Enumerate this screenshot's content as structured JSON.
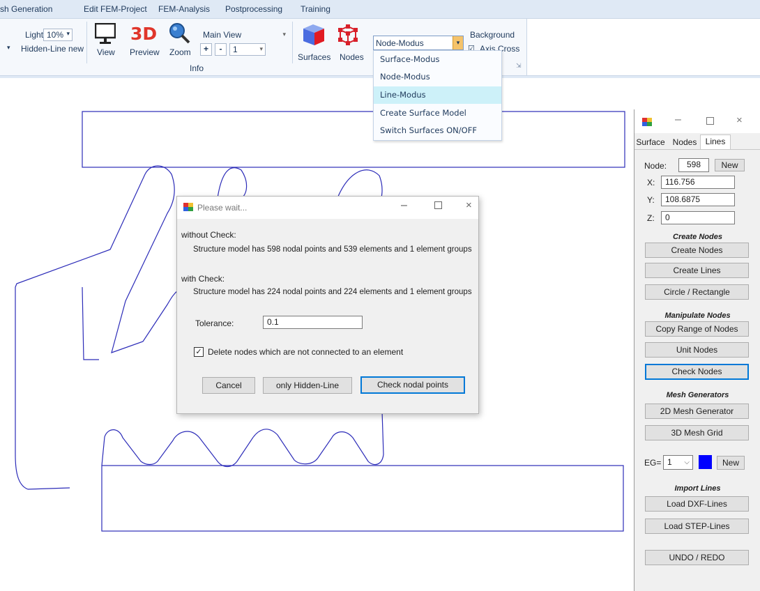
{
  "menu": [
    "sh Generation",
    "Edit FEM-Project",
    "FEM-Analysis",
    "Postprocessing",
    "Training"
  ],
  "ribbon": {
    "light_label": "Light",
    "light_value": "10%",
    "hidden_line_label": "Hidden-Line new",
    "view_label": "View",
    "preview_label": "Preview",
    "zoom_label": "Zoom",
    "view_combo": "Main View",
    "plus": "+",
    "minus": "-",
    "step_value": "1",
    "group_info": "Info",
    "surfaces_label": "Surfaces",
    "nodes_label": "Nodes",
    "mode_combo": "Node-Modus",
    "background_label": "Background",
    "axis_cross_label": "Axis Cross",
    "preview_icon_text": "3D"
  },
  "dropdown": {
    "items": [
      "Surface-Modus",
      "Node-Modus",
      "Line-Modus",
      "Create Surface Model",
      "Switch Surfaces ON/OFF"
    ],
    "highlighted_index": 2
  },
  "dialog": {
    "title": "Please wait...",
    "without_check_label": "without Check:",
    "without_check_text": "Structure model has  598 nodal points and  539 elements and  1 element groups",
    "with_check_label": "with Check:",
    "with_check_text": "Structure model has  224 nodal points and  224 elements and  1 element groups",
    "tolerance_label": "Tolerance:",
    "tolerance_value": "0.1",
    "delete_nodes_label": "Delete nodes which are not connected to an element",
    "delete_nodes_checked": true,
    "cancel_label": "Cancel",
    "hidden_line_label": "only Hidden-Line",
    "check_label": "Check nodal points"
  },
  "panel": {
    "tabs": [
      "Surface",
      "Nodes",
      "Lines"
    ],
    "active_tab": "Lines",
    "node_label": "Node:",
    "node_value": "598",
    "new_label": "New",
    "x_label": "X:",
    "x_value": "116.756",
    "y_label": "Y:",
    "y_value": "108.6875",
    "z_label": "Z:",
    "z_value": "0",
    "sec_create": "Create Nodes",
    "btn_create_nodes": "Create Nodes",
    "btn_create_lines": "Create Lines",
    "btn_circle": "Circle / Rectangle",
    "sec_manipulate": "Manipulate Nodes",
    "btn_copy_range": "Copy Range of Nodes",
    "btn_unit_nodes": "Unit Nodes",
    "btn_check_nodes": "Check Nodes",
    "sec_mesh": "Mesh Generators",
    "btn_2d_mesh": "2D Mesh Generator",
    "btn_3d_mesh": "3D Mesh Grid",
    "eg_label": "EG=",
    "eg_value": "1",
    "eg_color": "#0000ff",
    "eg_new_label": "New",
    "sec_import": "Import Lines",
    "btn_load_dxf": "Load DXF-Lines",
    "btn_load_step": "Load STEP-Lines",
    "btn_undo": "UNDO / REDO"
  },
  "colors": {
    "accent": "#0078d7",
    "model_lines": "#2b2bb8",
    "menu_bg": "#dfe9f5"
  }
}
